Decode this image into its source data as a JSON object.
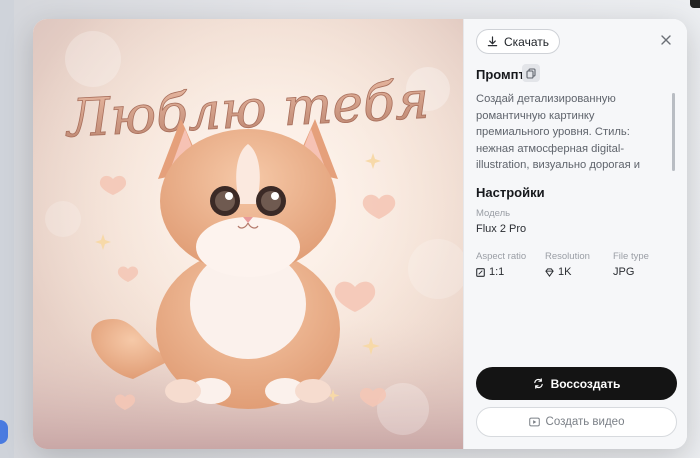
{
  "modal": {
    "image": {
      "lettering": "Люблю тебя"
    },
    "download_label": "Скачать",
    "prompt_title": "Промпт",
    "prompt_text": "Создай детализированную романтичную картинку премиального уровня. Стиль: нежная атмосферная digital-illustration, визуально дорогая и очень милая. Сюжет: милый пушистый",
    "settings_title": "Настройки",
    "model_label": "Модель",
    "model_value": "Flux 2 Pro",
    "aspect_label": "Aspect ratio",
    "aspect_value": "1:1",
    "resolution_label": "Resolution",
    "resolution_value": "1K",
    "filetype_label": "File type",
    "filetype_value": "JPG",
    "recreate_label": "Воссоздать",
    "video_label": "Создать видео"
  },
  "icons": {
    "download": "download-icon",
    "close": "close-icon",
    "copy": "copy-icon",
    "aspect": "aspect-ratio-icon",
    "resolution": "diamond-icon",
    "recreate": "repeat-icon",
    "video": "video-icon"
  },
  "colors": {
    "primary_button": "#141414",
    "panel_background": "#f6f7f9"
  }
}
